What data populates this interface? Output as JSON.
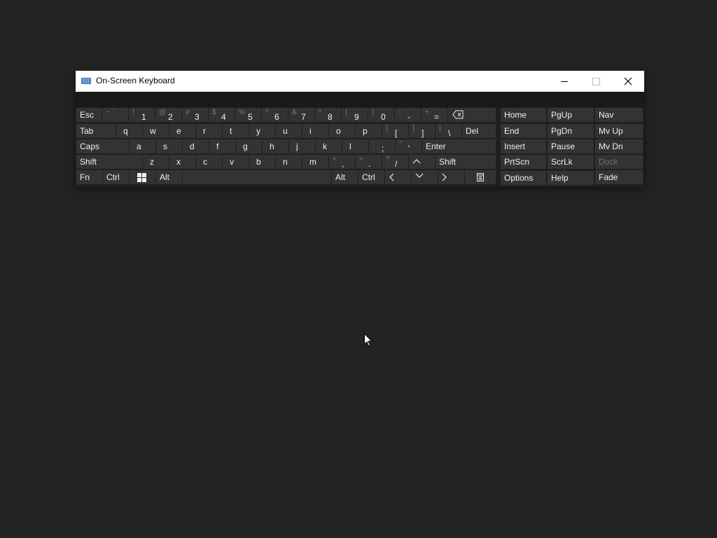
{
  "window": {
    "title": "On-Screen Keyboard",
    "icon": "keyboard-icon",
    "controls": [
      "minimize-icon",
      "maximize-icon",
      "close-icon"
    ]
  },
  "keys": {
    "esc": "Esc",
    "tilde": {
      "shift": "~ `",
      "main": ""
    },
    "n1": {
      "shift": "!",
      "main": "1"
    },
    "n2": {
      "shift": "@",
      "main": "2"
    },
    "n3": {
      "shift": "#",
      "main": "3"
    },
    "n4": {
      "shift": "$",
      "main": "4"
    },
    "n5": {
      "shift": "%",
      "main": "5"
    },
    "n6": {
      "shift": "^",
      "main": "6"
    },
    "n7": {
      "shift": "&",
      "main": "7"
    },
    "n8": {
      "shift": "*",
      "main": "8"
    },
    "n9": {
      "shift": "(",
      "main": "9"
    },
    "n0": {
      "shift": ")",
      "main": "0"
    },
    "minus": {
      "shift": "-",
      "main": "-"
    },
    "equals": {
      "shift": "+",
      "main": "="
    },
    "tab": "Tab",
    "q": "q",
    "w": "w",
    "e": "e",
    "r": "r",
    "t": "t",
    "y": "y",
    "u": "u",
    "i": "i",
    "o": "o",
    "p": "p",
    "lbracket": {
      "shift": "{",
      "main": "["
    },
    "rbracket": {
      "shift": "}",
      "main": "]"
    },
    "backslash": {
      "shift": "|",
      "main": "\\"
    },
    "del": "Del",
    "caps": "Caps",
    "a": "a",
    "s": "s",
    "d": "d",
    "f": "f",
    "g": "g",
    "h": "h",
    "j": "j",
    "k": "k",
    "l": "l",
    "semicolon": {
      "shift": ":",
      "main": ";"
    },
    "quote": {
      "shift": "\"",
      "main": "'"
    },
    "enter": "Enter",
    "shift_left": "Shift",
    "z": "z",
    "x": "x",
    "c": "c",
    "v": "v",
    "b": "b",
    "n": "n",
    "m": "m",
    "comma": {
      "shift": "<",
      "main": ","
    },
    "period": {
      "shift": ">",
      "main": "."
    },
    "slash": {
      "shift": "?",
      "main": "/"
    },
    "shift_right": "Shift",
    "fn": "Fn",
    "ctrl_left": "Ctrl",
    "alt_left": "Alt",
    "alt_right": "Alt",
    "ctrl_right": "Ctrl"
  },
  "side_keys": {
    "home": "Home",
    "pgup": "PgUp",
    "nav": "Nav",
    "end": "End",
    "pgdn": "PgDn",
    "mvup": "Mv Up",
    "insert": "Insert",
    "pause": "Pause",
    "mvdn": "Mv Dn",
    "prtscn": "PrtScn",
    "scrlk": "ScrLk",
    "dock": "Dock",
    "options": "Options",
    "help": "Help",
    "fade": "Fade"
  }
}
